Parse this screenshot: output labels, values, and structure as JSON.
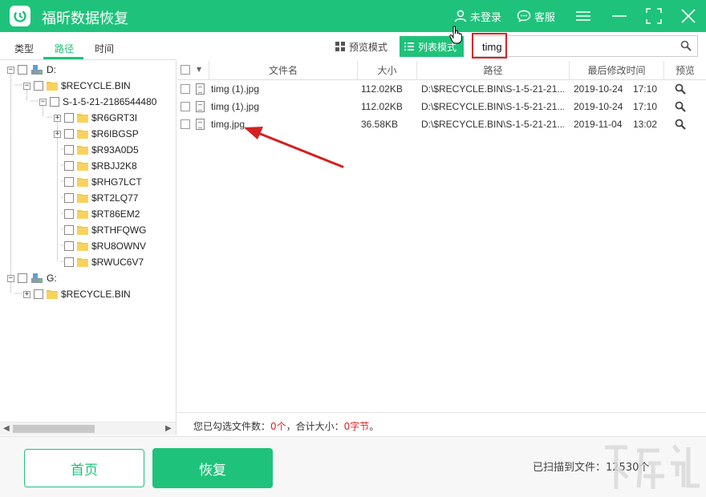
{
  "app": {
    "title": "福昕数据恢复"
  },
  "header": {
    "login_label": "未登录",
    "service_label": "客服"
  },
  "left_tabs": [
    "类型",
    "路径",
    "时间"
  ],
  "toolbar": {
    "preview_mode": "预览模式",
    "list_mode": "列表模式"
  },
  "search": {
    "value": "timg"
  },
  "tree": {
    "items": [
      {
        "label": "D:"
      },
      {
        "label": "$RECYCLE.BIN"
      },
      {
        "label": "S-1-5-21-2186544480"
      },
      {
        "label": "$R6GRT3I"
      },
      {
        "label": "$R6IBGSP"
      },
      {
        "label": "$R93A0D5"
      },
      {
        "label": "$RBJJ2K8"
      },
      {
        "label": "$RHG7LCT"
      },
      {
        "label": "$RT2LQ77"
      },
      {
        "label": "$RT86EM2"
      },
      {
        "label": "$RTHFQWG"
      },
      {
        "label": "$RU8OWNV"
      },
      {
        "label": "$RWUC6V7"
      },
      {
        "label": "G:"
      },
      {
        "label": "$RECYCLE.BIN"
      }
    ]
  },
  "table": {
    "columns": [
      "文件名",
      "大小",
      "路径",
      "最后修改时间",
      "预览"
    ],
    "rows": [
      {
        "name": "timg (1).jpg",
        "size": "112.02KB",
        "path": "D:\\$RECYCLE.BIN\\S-1-5-21-21...",
        "date": "2019-10-24",
        "time": "17:10"
      },
      {
        "name": "timg (1).jpg",
        "size": "112.02KB",
        "path": "D:\\$RECYCLE.BIN\\S-1-5-21-21...",
        "date": "2019-10-24",
        "time": "17:10"
      },
      {
        "name": "timg.jpg",
        "size": "36.58KB",
        "path": "D:\\$RECYCLE.BIN\\S-1-5-21-21...",
        "date": "2019-11-04",
        "time": "13:02"
      }
    ]
  },
  "status": {
    "prefix": "您已勾选文件数：",
    "count": "0个",
    "middle": "，合计大小：",
    "size": "0字节",
    "suffix": "。"
  },
  "footer": {
    "home_label": "首页",
    "recover_label": "恢复",
    "scan_count": "已扫描到文件：12530个"
  },
  "colors": {
    "accent": "#1fc27a",
    "alert": "#e02020"
  }
}
